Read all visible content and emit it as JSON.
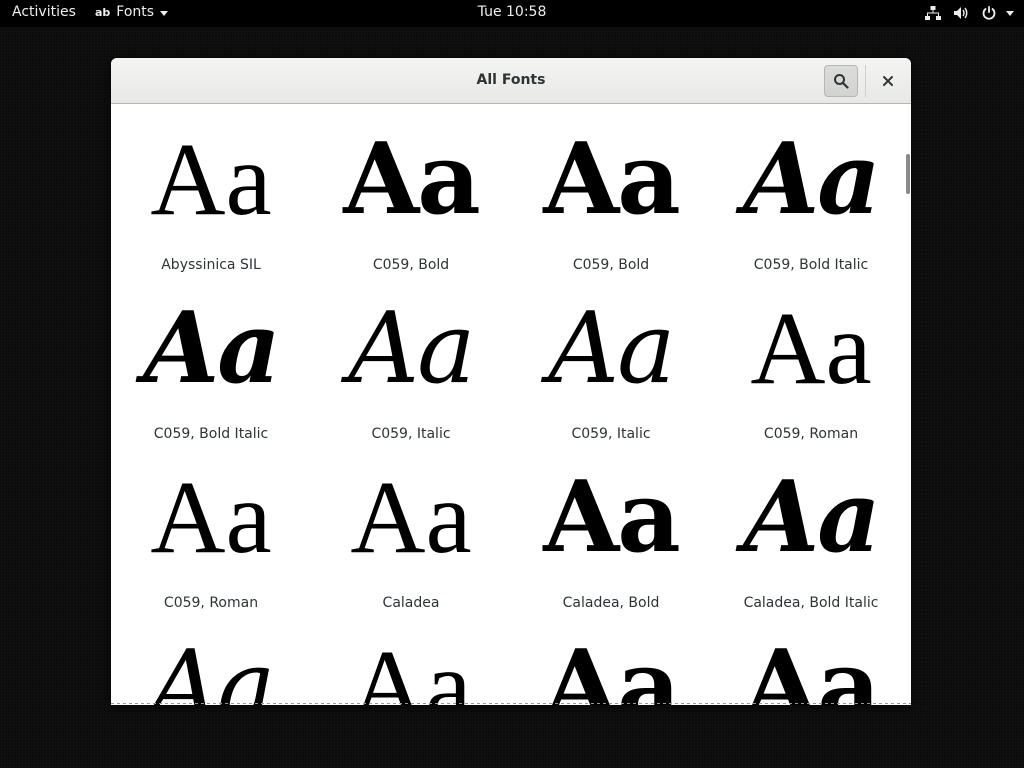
{
  "topbar": {
    "activities_label": "Activities",
    "app_icon_text": "ab",
    "app_name": "Fonts",
    "clock": "Tue 10:58",
    "status_icons": [
      "network-icon",
      "volume-icon",
      "power-icon"
    ]
  },
  "window": {
    "title": "All Fonts",
    "search_icon": "search-icon",
    "close_icon": "close-icon"
  },
  "fonts": [
    {
      "sample": "Aa",
      "label": "Abyssinica SIL",
      "style": "roman"
    },
    {
      "sample": "Aa",
      "label": "C059, Bold",
      "style": "bold"
    },
    {
      "sample": "Aa",
      "label": "C059, Bold",
      "style": "bold"
    },
    {
      "sample": "Aa",
      "label": "C059, Bold Italic",
      "style": "bold italic"
    },
    {
      "sample": "Aa",
      "label": "C059, Bold Italic",
      "style": "bold italic"
    },
    {
      "sample": "Aa",
      "label": "C059, Italic",
      "style": "italic"
    },
    {
      "sample": "Aa",
      "label": "C059, Italic",
      "style": "italic"
    },
    {
      "sample": "Aa",
      "label": "C059, Roman",
      "style": "roman"
    },
    {
      "sample": "Aa",
      "label": "C059, Roman",
      "style": "roman"
    },
    {
      "sample": "Aa",
      "label": "Caladea",
      "style": "roman"
    },
    {
      "sample": "Aa",
      "label": "Caladea, Bold",
      "style": "bold"
    },
    {
      "sample": "Aa",
      "label": "Caladea, Bold Italic",
      "style": "bold italic"
    },
    {
      "sample": "Aa",
      "label": "",
      "style": "italic"
    },
    {
      "sample": "Aa",
      "label": "",
      "style": "roman"
    },
    {
      "sample": "Aa",
      "label": "",
      "style": "bold"
    },
    {
      "sample": "Aa",
      "label": "",
      "style": "bold"
    }
  ],
  "colors": {
    "topbar_bg": "#000000",
    "topbar_text": "#eeeeec",
    "window_bg": "#ffffff",
    "headerbar_bg": "#e8e8e7",
    "label_text": "#2e3436"
  }
}
